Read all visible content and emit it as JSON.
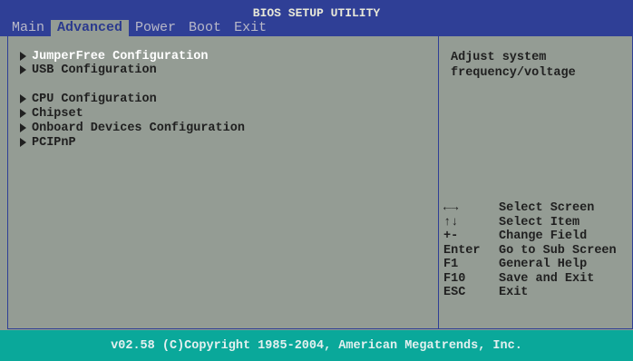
{
  "header": {
    "title": "BIOS SETUP UTILITY",
    "tabs": [
      {
        "label": "Main"
      },
      {
        "label": "Advanced"
      },
      {
        "label": "Power"
      },
      {
        "label": "Boot"
      },
      {
        "label": "Exit"
      }
    ],
    "active_tab": "Advanced"
  },
  "menu_items": [
    {
      "label": "JumperFree Configuration",
      "selected": true
    },
    {
      "label": "USB Configuration"
    },
    {
      "label": "CPU Configuration"
    },
    {
      "label": "Chipset"
    },
    {
      "label": "Onboard Devices Configuration"
    },
    {
      "label": "PCIPnP"
    }
  ],
  "help": {
    "lines": [
      "Adjust system",
      "frequency/voltage"
    ]
  },
  "keys": [
    {
      "key": "←→",
      "desc": "Select Screen"
    },
    {
      "key": "↑↓",
      "desc": "Select Item"
    },
    {
      "key": "+-",
      "desc": "Change Field"
    },
    {
      "key": "Enter",
      "desc": "Go to Sub Screen"
    },
    {
      "key": "F1",
      "desc": "General Help"
    },
    {
      "key": "F10",
      "desc": "Save and Exit"
    },
    {
      "key": "ESC",
      "desc": "Exit"
    }
  ],
  "footer": {
    "copyright": "v02.58 (C)Copyright 1985-2004, American Megatrends, Inc."
  },
  "colors": {
    "header_bg": "#2f3f96",
    "body_bg": "#949c94",
    "footer_bg": "#0aa89a",
    "selected_text": "#ffffff"
  }
}
